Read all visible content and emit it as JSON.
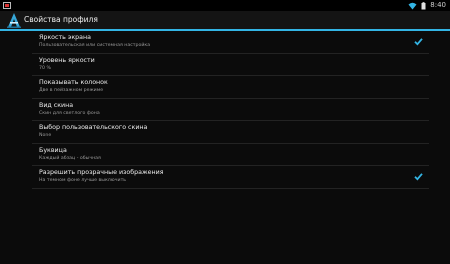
{
  "status_bar": {
    "time": "8:40"
  },
  "action_bar": {
    "title": "Свойства профиля"
  },
  "settings": [
    {
      "title": "Яркость экрана",
      "subtitle": "Пользовательская или системная настройка",
      "checked": true
    },
    {
      "title": "Уровень яркости",
      "subtitle": "70 %",
      "checked": false
    },
    {
      "title": "Показывать колонок",
      "subtitle": "Две в пейзажном режиме",
      "checked": false
    },
    {
      "title": "Вид скина",
      "subtitle": "Скин для светлого фона",
      "checked": false
    },
    {
      "title": "Выбор пользовательского скина",
      "subtitle": "None",
      "checked": false
    },
    {
      "title": "Буквица",
      "subtitle": "Каждый абзац - обычная",
      "checked": false
    },
    {
      "title": "Разрешить прозрачные изображения",
      "subtitle": "На темном фоне лучше выключить",
      "checked": true
    }
  ],
  "colors": {
    "accent": "#33b5e5",
    "background": "#0b0b0b"
  }
}
